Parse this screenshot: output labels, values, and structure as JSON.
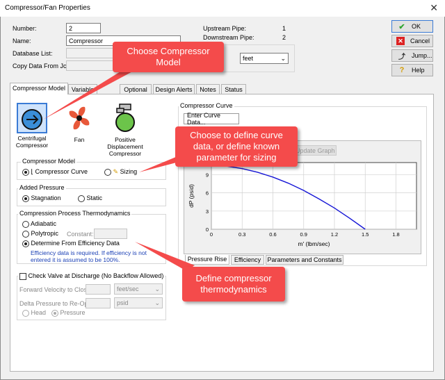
{
  "window": {
    "title": "Compressor/Fan Properties"
  },
  "fields": {
    "number_label": "Number:",
    "number_value": "2",
    "name_label": "Name:",
    "name_value": "Compressor",
    "database_label": "Database List:",
    "copy_label": "Copy Data From Jct...",
    "upstream_label": "Upstream Pipe:",
    "upstream_value": "1",
    "downstream_label": "Downstream Pipe:",
    "downstream_value": "2",
    "units_value": "feet"
  },
  "buttons": {
    "ok": "OK",
    "cancel": "Cancel",
    "jump": "Jump...",
    "help": "Help"
  },
  "tabs": [
    "Compressor Model",
    "Variable",
    "Optional",
    "Design Alerts",
    "Notes",
    "Status"
  ],
  "model_icons": [
    {
      "caption": "Centrifugal\nCompressor"
    },
    {
      "caption": "Fan"
    },
    {
      "caption": "Positive\nDisplacement\nCompressor"
    }
  ],
  "compressor_model": {
    "title": "Compressor Model",
    "curve": "Compressor Curve",
    "sizing": "Sizing"
  },
  "added_pressure": {
    "title": "Added Pressure",
    "stagnation": "Stagnation",
    "static": "Static"
  },
  "thermo": {
    "title": "Compression Process Thermodynamics",
    "adiabatic": "Adiabatic",
    "polytropic": "Polytropic",
    "constant": "Constant:",
    "efficiency": "Determine From Efficiency Data",
    "note1": "Efficiency data is required. If efficiency is not",
    "note2": "entered it is assumed to be 100%."
  },
  "check_valve": {
    "title": "Check Valve at Discharge (No Backflow Allowed)",
    "forward_velocity": "Forward Velocity to Close",
    "velocity_unit": "feet/sec",
    "delta_pressure": "Delta Pressure to Re-Open",
    "pressure_unit": "psid",
    "head": "Head",
    "pressure": "Pressure"
  },
  "curve_panel": {
    "title": "Compressor Curve",
    "enter_button": "Enter Curve Data...",
    "update_button": "Update Graph"
  },
  "subtabs": [
    "Pressure Rise",
    "Efficiency",
    "Parameters and Constants"
  ],
  "callouts": {
    "model": "Choose Compressor\nModel",
    "curve": "Choose to define curve\ndata, or define known\nparameter for sizing",
    "thermo": "Define compressor\nthermodynamics"
  },
  "chart_data": {
    "type": "line",
    "xlabel": "m' (lbm/sec)",
    "ylabel": "dP (psid)",
    "xticks": [
      0,
      0.3,
      0.6,
      0.9,
      1.2,
      1.5,
      1.8
    ],
    "yticks": [
      0,
      3,
      6,
      9
    ],
    "xlim": [
      0,
      2.0
    ],
    "ylim": [
      0,
      11
    ],
    "grid": true,
    "series": [
      {
        "color": "#1515d6",
        "x": [
          0,
          0.15,
          0.3,
          0.45,
          0.6,
          0.75,
          0.9,
          1.05,
          1.2,
          1.35,
          1.5
        ],
        "y": [
          10.5,
          10.4,
          10.0,
          9.4,
          8.6,
          7.6,
          6.4,
          5.0,
          3.5,
          1.8,
          0
        ]
      }
    ]
  }
}
